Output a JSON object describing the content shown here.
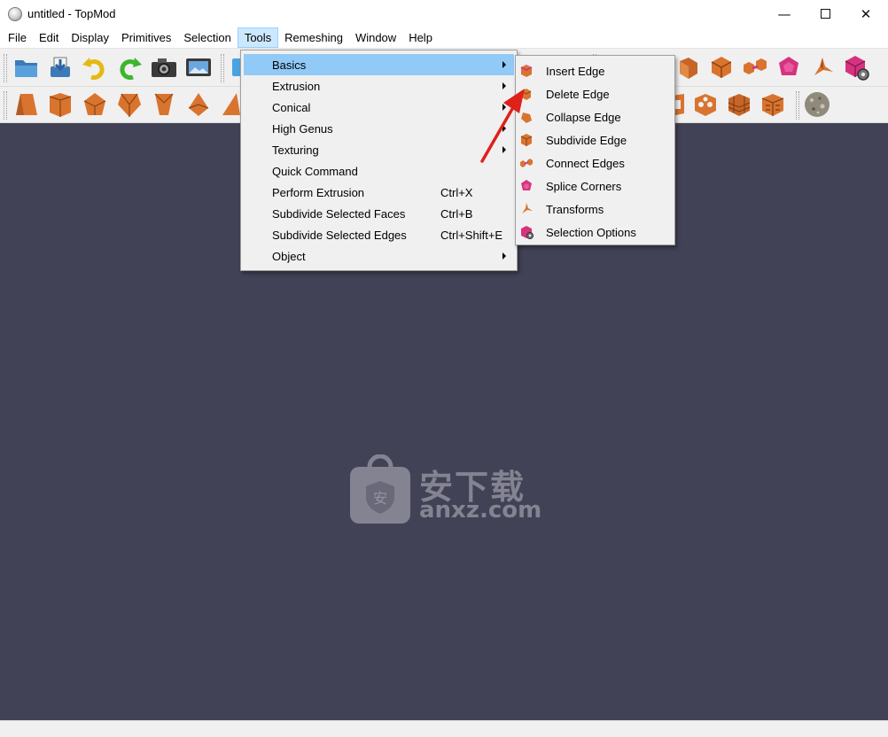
{
  "window": {
    "title": "untitled - TopMod",
    "minimize_glyph": "—",
    "close_glyph": "✕"
  },
  "menubar": {
    "items": [
      {
        "label": "File"
      },
      {
        "label": "Edit"
      },
      {
        "label": "Display"
      },
      {
        "label": "Primitives"
      },
      {
        "label": "Selection"
      },
      {
        "label": "Tools"
      },
      {
        "label": "Remeshing"
      },
      {
        "label": "Window"
      },
      {
        "label": "Help"
      }
    ],
    "active": "Tools"
  },
  "tools_menu": {
    "items": [
      {
        "label": "Basics",
        "shortcut": "",
        "submenu": true
      },
      {
        "label": "Extrusion",
        "shortcut": "",
        "submenu": true
      },
      {
        "label": "Conical",
        "shortcut": "",
        "submenu": true
      },
      {
        "label": "High Genus",
        "shortcut": "",
        "submenu": true
      },
      {
        "label": "Texturing",
        "shortcut": "",
        "submenu": true
      },
      {
        "label": "Quick Command",
        "shortcut": "",
        "submenu": false
      },
      {
        "label": "Perform Extrusion",
        "shortcut": "Ctrl+X",
        "submenu": false
      },
      {
        "label": "Subdivide Selected Faces",
        "shortcut": "Ctrl+B",
        "submenu": false
      },
      {
        "label": "Subdivide Selected Edges",
        "shortcut": "Ctrl+Shift+E",
        "submenu": false
      },
      {
        "label": "Object",
        "shortcut": "",
        "submenu": true
      }
    ],
    "highlighted": "Basics"
  },
  "basics_submenu": {
    "items": [
      {
        "label": "Insert Edge",
        "icon": "insert-edge-icon"
      },
      {
        "label": "Delete Edge",
        "icon": "delete-edge-icon"
      },
      {
        "label": "Collapse Edge",
        "icon": "collapse-edge-icon"
      },
      {
        "label": "Subdivide Edge",
        "icon": "subdivide-edge-icon"
      },
      {
        "label": "Connect Edges",
        "icon": "connect-edges-icon"
      },
      {
        "label": "Splice Corners",
        "icon": "splice-corners-icon"
      },
      {
        "label": "Transforms",
        "icon": "transforms-icon"
      },
      {
        "label": "Selection Options",
        "icon": "selection-options-icon"
      }
    ]
  },
  "watermark": {
    "cn": "安下载",
    "en": "anxz.com",
    "badge": "安"
  },
  "colors": {
    "viewport_bg": "#424256",
    "menu_highlight": "#91c9f7",
    "shape_orange": "#d9742f",
    "shape_magenta": "#d6337f",
    "annotation_red": "#e0201b"
  }
}
